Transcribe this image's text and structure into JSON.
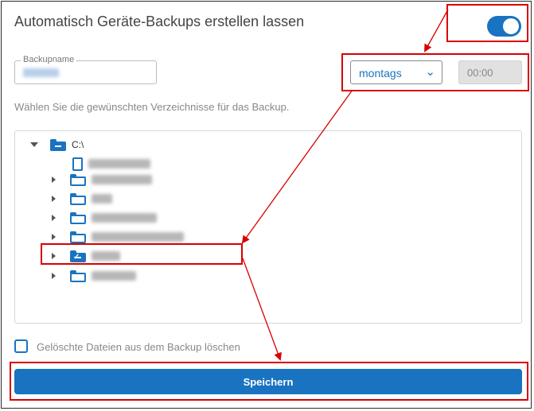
{
  "header": {
    "title": "Automatisch Geräte-Backups erstellen lassen",
    "toggle_on": true
  },
  "backup_name": {
    "label": "Backupname",
    "value": ""
  },
  "schedule": {
    "day": "montags",
    "time": "00:00"
  },
  "hint": "Wählen Sie die gewünschten Verzeichnisse für das Backup.",
  "tree": {
    "root_label": "C:\\"
  },
  "delete_option": {
    "label": "Gelöschte Dateien aus dem Backup löschen",
    "checked": false
  },
  "save_label": "Speichern",
  "colors": {
    "accent": "#1a73c0",
    "annotation": "#d80000"
  }
}
